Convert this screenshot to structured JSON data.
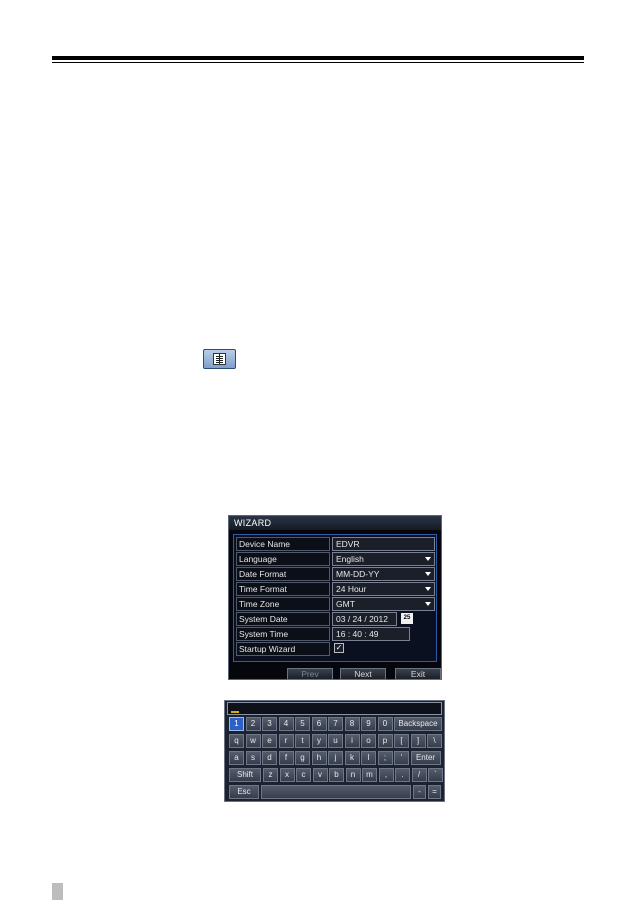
{
  "wizard": {
    "title": "WIZARD",
    "rows": [
      {
        "label": "Device Name",
        "value": "EDVR"
      },
      {
        "label": "Language",
        "value": "English"
      },
      {
        "label": "Date Format",
        "value": "MM-DD-YY"
      },
      {
        "label": "Time Format",
        "value": "24 Hour"
      },
      {
        "label": "Time Zone",
        "value": "GMT"
      },
      {
        "label": "System Date",
        "value": "03 / 24 / 2012"
      },
      {
        "label": "System Time",
        "value": "16 : 40 : 49"
      },
      {
        "label": "Startup Wizard",
        "value": "✓"
      }
    ],
    "calendar_icon_text": "25",
    "buttons": {
      "prev": "Prev",
      "next": "Next",
      "exit": "Exit"
    }
  },
  "keyboard": {
    "rows": [
      [
        "1",
        "2",
        "3",
        "4",
        "5",
        "6",
        "7",
        "8",
        "9",
        "0",
        "Backspace"
      ],
      [
        "q",
        "w",
        "e",
        "r",
        "t",
        "y",
        "u",
        "i",
        "o",
        "p",
        "[",
        "]",
        "\\"
      ],
      [
        "a",
        "s",
        "d",
        "f",
        "g",
        "h",
        "j",
        "k",
        "l",
        ";",
        "'",
        "Enter"
      ],
      [
        "Shift",
        "z",
        "x",
        "c",
        "v",
        "b",
        "n",
        "m",
        ",",
        ".",
        "/",
        "`"
      ],
      [
        "Esc",
        "",
        "-",
        "="
      ]
    ]
  }
}
